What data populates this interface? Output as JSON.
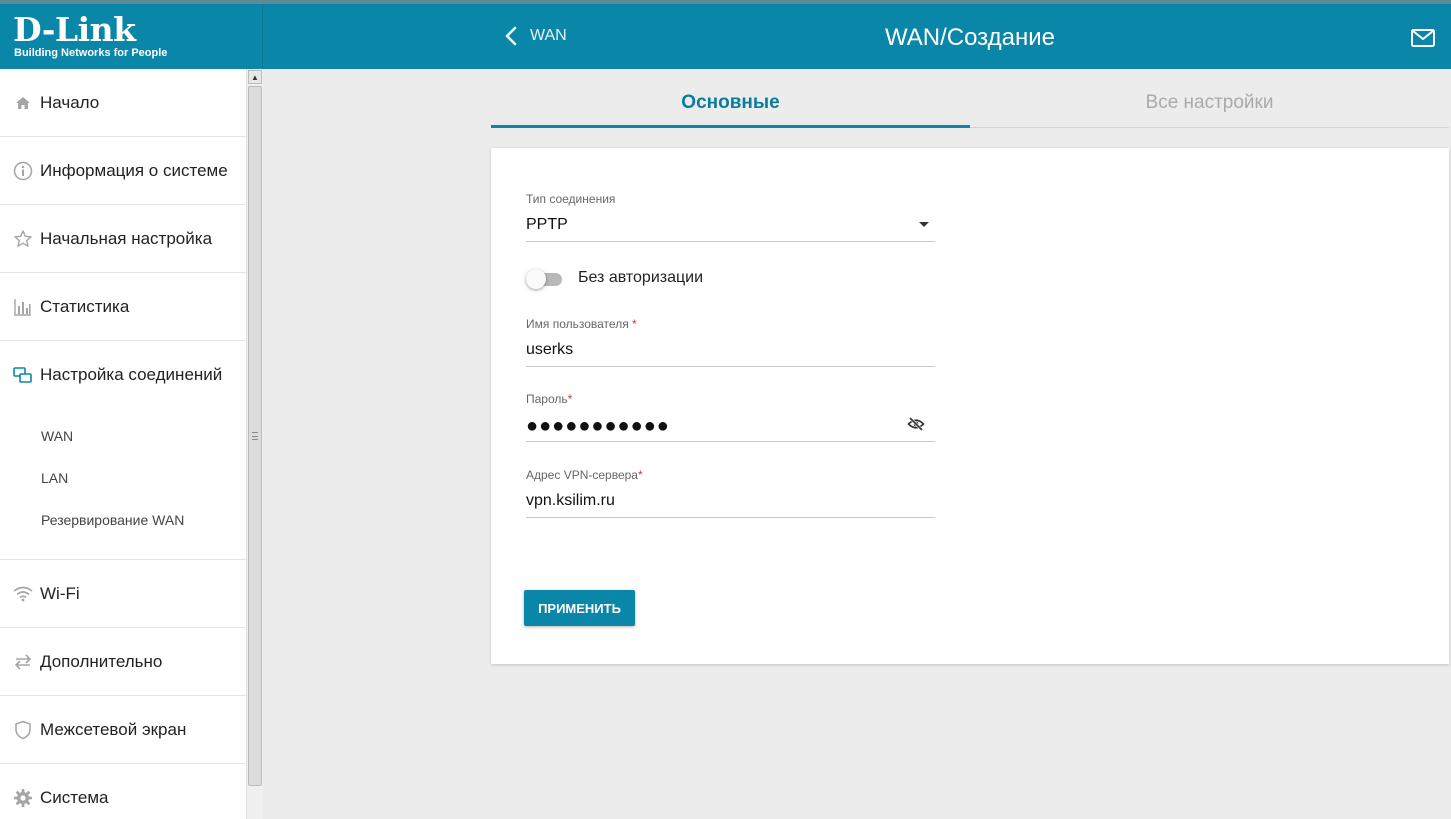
{
  "header": {
    "logo": "D-Link",
    "logo_tagline": "Building Networks for People",
    "back_label": "WAN",
    "title": "WAN/Создание",
    "accent_color": "#0a87a8"
  },
  "sidebar": {
    "items": [
      {
        "icon": "home-icon",
        "label": "Начало"
      },
      {
        "icon": "info-icon",
        "label": "Информация о системе"
      },
      {
        "icon": "star-icon",
        "label": "Начальная настройка"
      },
      {
        "icon": "bar-chart-icon",
        "label": "Статистика"
      },
      {
        "icon": "network-icon",
        "label": "Настройка соединений"
      },
      {
        "icon": "wifi-icon",
        "label": "Wi-Fi"
      },
      {
        "icon": "arrows-icon",
        "label": "Дополнительно"
      },
      {
        "icon": "shield-icon",
        "label": "Межсетевой экран"
      },
      {
        "icon": "gear-icon",
        "label": "Система"
      }
    ],
    "sub_items": [
      "WAN",
      "LAN",
      "Резервирование WAN"
    ]
  },
  "tabs": {
    "main": "Основные",
    "all": "Все настройки"
  },
  "form": {
    "connection_type_label": "Тип соединения",
    "connection_type_value": "PPTP",
    "no_auth_label": "Без авторизации",
    "no_auth_enabled": false,
    "username_label": "Имя пользователя",
    "username_value": "userks",
    "password_label": "Пароль",
    "password_mask": "●●●●●●●●●●●",
    "vpn_label": "Адрес VPN-сервера",
    "vpn_value": "vpn.ksilim.ru",
    "required_mark": "*",
    "apply_label": "ПРИМЕНИТЬ"
  }
}
